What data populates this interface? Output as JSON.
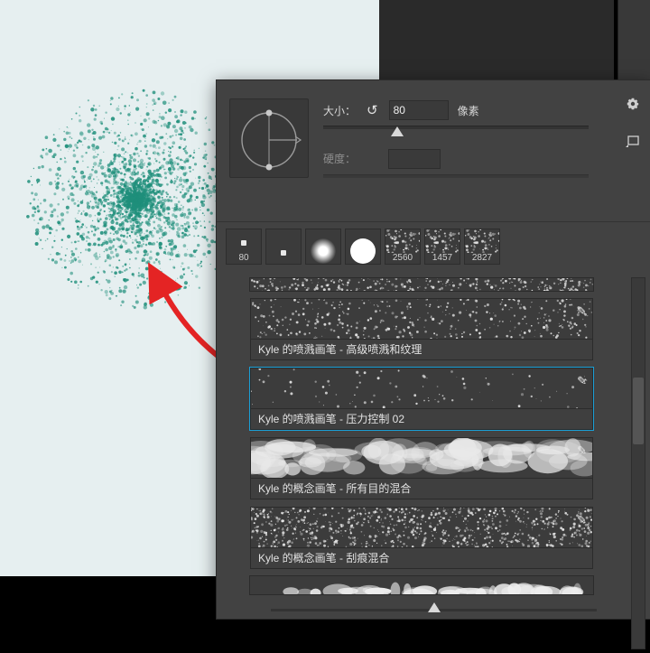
{
  "size": {
    "label": "大小：",
    "value": "80",
    "unit": "像素"
  },
  "hardness": {
    "label": "硬度："
  },
  "recent": [
    {
      "kind": "dot",
      "size": "80"
    },
    {
      "kind": "dot",
      "size": ""
    },
    {
      "kind": "soft",
      "size": ""
    },
    {
      "kind": "hard",
      "size": ""
    },
    {
      "kind": "tex",
      "size": "2560"
    },
    {
      "kind": "tex",
      "size": "1457"
    },
    {
      "kind": "tex",
      "size": "2827"
    }
  ],
  "brushes": [
    {
      "name": "Kyle",
      "mid": "的喷溅画笔",
      "suffix": "高级喷溅和纹理",
      "selected": false,
      "style": "speckle"
    },
    {
      "name": "Kyle",
      "mid": "的喷溅画笔",
      "suffix": "压力控制",
      "code": "02",
      "selected": true,
      "style": "sparse-dots"
    },
    {
      "name": "Kyle",
      "mid": "的概念画笔",
      "suffix": "所有目的混合",
      "selected": false,
      "style": "cloud"
    },
    {
      "name": "Kyle",
      "mid": "的概念画笔",
      "suffix": "刮痕混合",
      "selected": false,
      "style": "noise"
    }
  ]
}
